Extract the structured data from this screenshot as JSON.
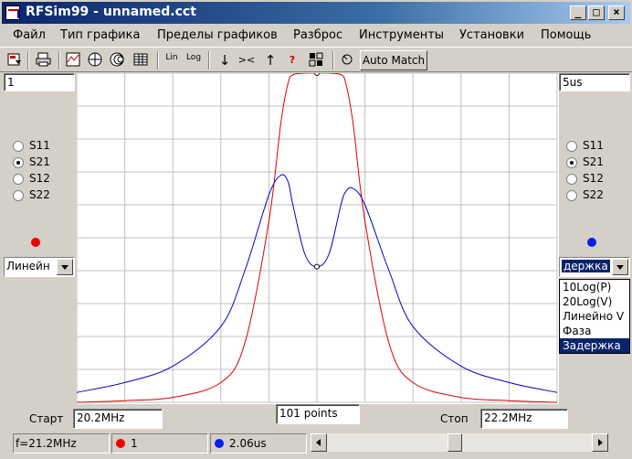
{
  "window": {
    "title": "RFSim99 - unnamed.cct"
  },
  "menu": [
    "Файл",
    "Тип графика",
    "Пределы графиков",
    "Разброс",
    "Инструменты",
    "Установки",
    "Помощь"
  ],
  "toolbar": {
    "auto_match_label": "Auto Match",
    "lin_label": "Lin",
    "log_label": "Log",
    "help_label": "?"
  },
  "left_panel": {
    "scale_value": "1",
    "radios": [
      {
        "label": "S11",
        "checked": false
      },
      {
        "label": "S21",
        "checked": true
      },
      {
        "label": "S12",
        "checked": false
      },
      {
        "label": "S22",
        "checked": false
      }
    ],
    "marker_color": "#ee0000",
    "mode_value": "Линейн"
  },
  "right_panel": {
    "scale_value": "5us",
    "radios": [
      {
        "label": "S11",
        "checked": false
      },
      {
        "label": "S21",
        "checked": true
      },
      {
        "label": "S12",
        "checked": false
      },
      {
        "label": "S22",
        "checked": false
      }
    ],
    "marker_color": "#0020ee",
    "mode_value": "держка",
    "dropdown_options": [
      "10Log(P)",
      "20Log(V)",
      "Линейно V",
      "Фаза",
      "Задержка"
    ],
    "dropdown_selected_index": 4
  },
  "bottom": {
    "start_label": "Старт",
    "start_value": "20.2MHz",
    "points_value": "101 points",
    "stop_label": "Стоп",
    "stop_value": "22.2MHz"
  },
  "status": {
    "freq": "f=21.2MHz",
    "left_value": "1",
    "right_value": "2.06us"
  },
  "chart_data": {
    "type": "line",
    "x_range": [
      20.2,
      22.2
    ],
    "x_unit": "MHz",
    "grid": true,
    "grid_cols": 10,
    "grid_rows": 10,
    "series": [
      {
        "color": "#dd0000",
        "axis": "left",
        "ylim": [
          0,
          1
        ],
        "x": [
          20.2,
          20.4,
          20.6,
          20.8,
          20.9,
          21.0,
          21.05,
          21.08,
          21.1,
          21.15,
          21.2,
          21.25,
          21.3,
          21.32,
          21.35,
          21.4,
          21.5,
          21.6,
          21.8,
          22.0,
          22.2
        ],
        "y": [
          0.0,
          0.005,
          0.015,
          0.06,
          0.18,
          0.55,
          0.85,
          0.97,
          0.995,
          1.0,
          1.0,
          1.0,
          0.995,
          0.97,
          0.85,
          0.55,
          0.18,
          0.06,
          0.015,
          0.005,
          0.0
        ]
      },
      {
        "color": "#0000cc",
        "axis": "right",
        "ylim": [
          0,
          5
        ],
        "x": [
          20.2,
          20.4,
          20.6,
          20.8,
          20.9,
          21.0,
          21.05,
          21.08,
          21.1,
          21.15,
          21.2,
          21.25,
          21.3,
          21.32,
          21.35,
          21.4,
          21.5,
          21.6,
          21.8,
          22.0,
          22.2
        ],
        "y": [
          0.15,
          0.3,
          0.55,
          1.15,
          2.0,
          3.15,
          3.45,
          3.35,
          3.0,
          2.25,
          2.06,
          2.25,
          3.0,
          3.2,
          3.25,
          3.0,
          2.0,
          1.15,
          0.55,
          0.3,
          0.15
        ]
      }
    ]
  }
}
